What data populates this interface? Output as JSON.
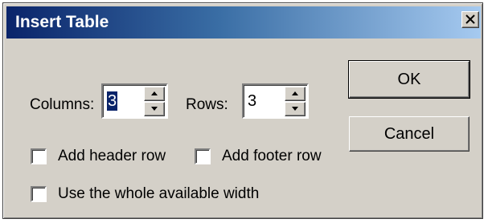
{
  "window": {
    "title": "Insert Table",
    "close_icon": "close-x-icon"
  },
  "columns": {
    "label": "Columns:",
    "value": "3",
    "selected": true
  },
  "rows": {
    "label": "Rows:",
    "value": "3"
  },
  "buttons": {
    "ok_label": "OK",
    "cancel_label": "Cancel"
  },
  "options": {
    "header_row": {
      "label": "Add header row",
      "checked": false
    },
    "footer_row": {
      "label": "Add footer row",
      "checked": false
    },
    "whole_width": {
      "label": "Use the whole available width",
      "checked": false
    }
  },
  "colors": {
    "title_gradient_start": "#0a246a",
    "title_gradient_end": "#a6caf0",
    "dialog_bg": "#d4d0c8",
    "selection": "#0a246a"
  }
}
